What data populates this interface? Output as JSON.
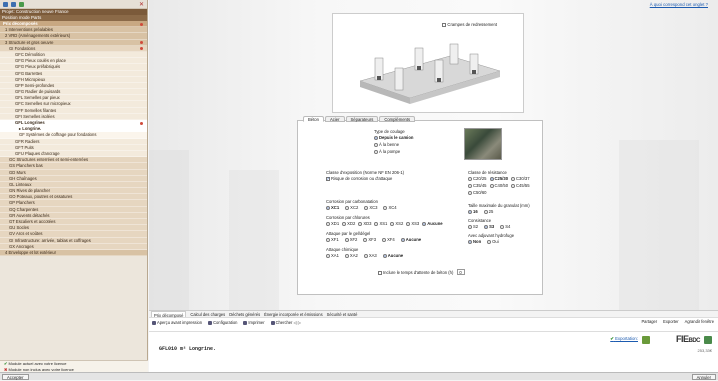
{
  "sidebar": {
    "project_title": "Projet: Construction neuve France",
    "project_sub": "Position mode Parts",
    "items": [
      {
        "label": "Prix décomposés",
        "level": 1,
        "dot": true
      },
      {
        "label": "1  Interventions préalables",
        "level": 2
      },
      {
        "label": "2  VRD (Aménagements extérieurs)",
        "level": 2
      },
      {
        "label": "3  Structure et gros oeuvre",
        "level": 2,
        "dot": true
      },
      {
        "label": "GI   Fondations",
        "level": 3,
        "dot": true
      },
      {
        "label": "GFC  Démolition",
        "level": 4
      },
      {
        "label": "GFG  Pieux coulés en place",
        "level": 4
      },
      {
        "label": "GFG  Pieux préfabriqués",
        "level": 4
      },
      {
        "label": "GFG  Barrettes",
        "level": 4
      },
      {
        "label": "GFH  Micropieux",
        "level": 4
      },
      {
        "label": "GFP  Semi-profondes",
        "level": 4
      },
      {
        "label": "GFG  Radier de puisards",
        "level": 4
      },
      {
        "label": "GFL  Semelles par pieux",
        "level": 4
      },
      {
        "label": "GFC  Semelles sur micropieux",
        "level": 4
      },
      {
        "label": "GFF  Semelles filantes",
        "level": 4
      },
      {
        "label": "GFI  Semelles isolées",
        "level": 4
      },
      {
        "label": "GFL  Longrines",
        "level": 4,
        "active": true,
        "dot": true
      },
      {
        "label": "▸ Longrine.",
        "level": 5,
        "active": true
      },
      {
        "label": "GF  Systèmes de coffrage pour fondations",
        "level": 5
      },
      {
        "label": "GFR  Radiers",
        "level": 4
      },
      {
        "label": "GFT  Puits",
        "level": 4
      },
      {
        "label": "GFU  Plaques d'ancrage",
        "level": 4
      },
      {
        "label": "GC  Structures enterrées et semi-enterrées",
        "level": 3
      },
      {
        "label": "GS  Planchers bas",
        "level": 3
      },
      {
        "label": "GD  Murs",
        "level": 3
      },
      {
        "label": "GH  Chaînages",
        "level": 3
      },
      {
        "label": "GL  Linteaux",
        "level": 3
      },
      {
        "label": "GN  Rives de plancher",
        "level": 3
      },
      {
        "label": "GO  Poteaux, poutres et ossatures",
        "level": 3
      },
      {
        "label": "GP  Planchers",
        "level": 3
      },
      {
        "label": "GQ  Charpentes",
        "level": 3
      },
      {
        "label": "GR  Auvents détachés",
        "level": 3
      },
      {
        "label": "GT  Escaliers et accotées",
        "level": 3
      },
      {
        "label": "GU  Socles",
        "level": 3
      },
      {
        "label": "GV  Arcs et voûtes",
        "level": 3
      },
      {
        "label": "GI   Infrastructure: arrivée, tablas et coffrages",
        "level": 3
      },
      {
        "label": "GX  Ancrages",
        "level": 3
      },
      {
        "label": "4  Enveloppe et lot extérieur",
        "level": 2
      }
    ],
    "status1": "Module actuel avec votre licence",
    "status2": "Module non inclus avec votre licence"
  },
  "main": {
    "top_link": "À quoi correspond cet onglet ?",
    "preview_checkbox": "Crampes de redressement",
    "tabs": [
      "Béton",
      "Acier",
      "Séparateurs",
      "Compléments"
    ],
    "type_title": "Type de coulage",
    "type_options": [
      "Depuis le camion",
      "À la benne",
      "À la pompe"
    ],
    "exposure_title": "Classe d'exposition (Norme NF EN 206-1)",
    "exposure_check": "Risque de corrosion ou d'attaque",
    "carbon_title": "Corrosion par carbonatation",
    "carbon_options": [
      "XC1",
      "XC2",
      "XC3",
      "XC4"
    ],
    "chloride_title": "Corrosion par chlorures",
    "chloride_options": [
      "XD1",
      "XD2",
      "XD3",
      "XS1",
      "XS2",
      "XS3",
      "Aucune"
    ],
    "frost_title": "Attaque par le gel/dégel",
    "frost_options": [
      "XF1",
      "XF2",
      "XF3",
      "XF4",
      "Aucune"
    ],
    "chem_title": "Attaque chimique",
    "chem_options": [
      "XA1",
      "XA2",
      "XA3",
      "Aucune"
    ],
    "resist_title": "Classe de résistance",
    "resist_options": [
      "C20/25",
      "C25/30",
      "C30/37",
      "C35/45",
      "C40/50",
      "C45/55",
      "C50/60"
    ],
    "size_title": "Taille maximale du granulat (mm)",
    "size_options": [
      "16",
      "25"
    ],
    "consist_title": "Consistance",
    "consist_options": [
      "S2",
      "S3",
      "S4"
    ],
    "hydro_title": "Avec adjuvant hydrofuge",
    "hydro_options": [
      "Non",
      "Oui"
    ],
    "bottom_check": "Inclure le temps d'attente de béton (h)",
    "bottom_value": "0"
  },
  "bottom": {
    "tabs": [
      "Prix décomposé",
      "Calcul des charges",
      "Déchets générés",
      "Énergie incorporée et émissions",
      "Sécurité et santé"
    ],
    "tools": [
      "Aperçu avant impression",
      "Configuration",
      "Imprimer",
      "Chercher"
    ],
    "tools_right": [
      "Partager",
      "Exporter",
      "Agrandir fenêtre"
    ],
    "doc_title": "GFL010  m²  Longrine.",
    "export_link": "Exportation:",
    "logo_fie": "FIE",
    "logo_bdc": "BDC",
    "pages": "253,33€"
  },
  "footer": {
    "accept": "Accepter",
    "cancel": "Annuler"
  },
  "colors": {
    "accent": "#1c5bb0",
    "sidebar": "#c8a882",
    "dot": "#d04a3a"
  }
}
